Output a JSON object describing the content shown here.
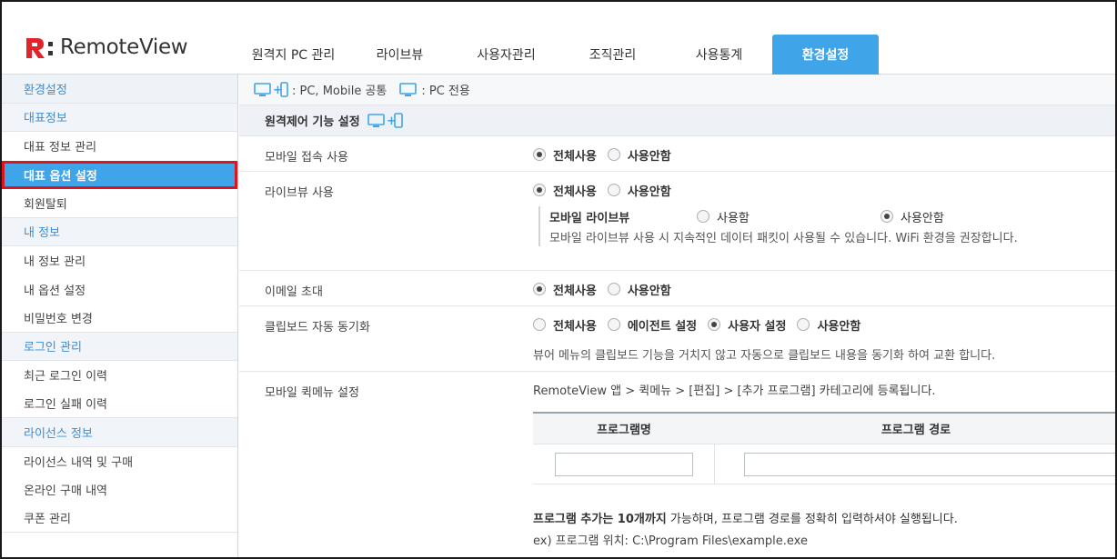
{
  "app": {
    "logo_text": "RemoteView"
  },
  "tabs": [
    {
      "label": "원격지 PC 관리"
    },
    {
      "label": "라이브뷰"
    },
    {
      "label": "사용자관리"
    },
    {
      "label": "조직관리"
    },
    {
      "label": "사용통계"
    },
    {
      "label": "환경설정",
      "active": true
    }
  ],
  "sidebar": {
    "groups": [
      {
        "title": "환경설정",
        "items": []
      },
      {
        "title": "대표정보",
        "items": [
          "대표 정보 관리",
          "대표 옵션 설정",
          "회원탈퇴"
        ]
      },
      {
        "title": "내 정보",
        "items": [
          "내 정보 관리",
          "내 옵션 설정",
          "비밀번호 변경"
        ]
      },
      {
        "title": "로그인 관리",
        "items": [
          "최근 로그인 이력",
          "로그인 실패 이력"
        ]
      },
      {
        "title": "라이선스 정보",
        "items": [
          "라이선스 내역 및 구매",
          "온라인 구매 내역",
          "쿠폰 관리"
        ]
      }
    ],
    "selected": "대표 옵션 설정"
  },
  "legend": {
    "both_text": ": PC, Mobile 공통",
    "pc_text": ": PC 전용"
  },
  "section": {
    "title": "원격제어 기능 설정"
  },
  "settings": {
    "mobile_access": {
      "label": "모바일 접속 사용",
      "options": [
        "전체사용",
        "사용안함"
      ],
      "selected": "전체사용"
    },
    "liveview": {
      "label": "라이브뷰 사용",
      "options": [
        "전체사용",
        "사용안함"
      ],
      "selected": "전체사용",
      "sub_label": "모바일 라이브뷰",
      "sub_options": [
        "사용함",
        "사용안함"
      ],
      "sub_selected": "사용안함",
      "sub_desc": "모바일 라이브뷰 사용 시 지속적인 데이터 패킷이 사용될 수 있습니다. WiFi 환경을 권장합니다."
    },
    "email_invite": {
      "label": "이메일 초대",
      "options": [
        "전체사용",
        "사용안함"
      ],
      "selected": "전체사용"
    },
    "clipboard": {
      "label": "클립보드 자동 동기화",
      "options": [
        "전체사용",
        "에이전트 설정",
        "사용자 설정",
        "사용안함"
      ],
      "selected": "사용자 설정",
      "desc": "뷰어 메뉴의 클립보드 기능을 거치지 않고 자동으로 클립보드 내용을 동기화 하여 교환 합니다."
    },
    "quick_menu": {
      "label": "모바일 퀵메뉴 설정",
      "desc": "RemoteView 앱 > 퀵메뉴 > [편집] > [추가 프로그램] 카테고리에 등록됩니다.",
      "col_name": "프로그램명",
      "col_path": "프로그램 경로",
      "note_bold": "프로그램 추가는 10개까지",
      "note_rest": " 가능하며, 프로그램 경로를 정확히 입력하셔야 실행됩니다.",
      "example": "ex) 프로그램 위치: C:\\Program Files\\example.exe"
    }
  },
  "colors": {
    "accent": "#3fa5e8",
    "highlight": "#e0141e",
    "logo_red": "#e0242a"
  }
}
